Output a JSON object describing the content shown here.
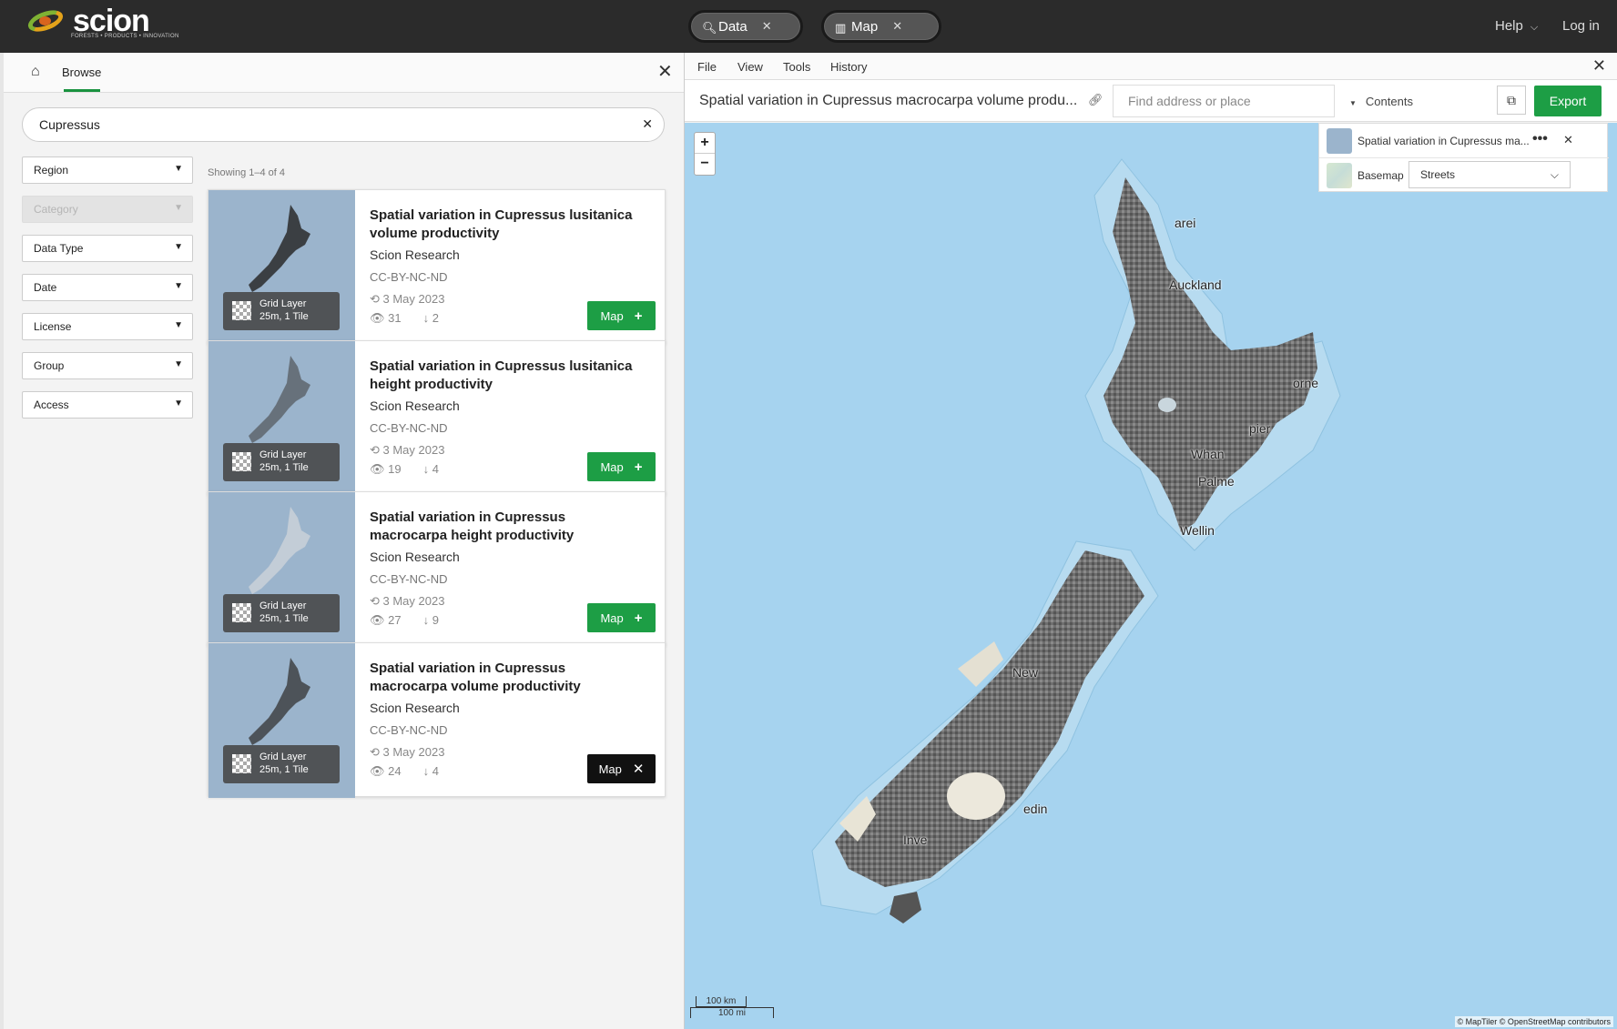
{
  "app": {
    "logo_text": "scion",
    "logo_tagline": "FORESTS • PRODUCTS • INNOVATION"
  },
  "topbar": {
    "tabs": [
      {
        "label": "Data",
        "icon": "search-icon"
      },
      {
        "label": "Map",
        "icon": "map-icon"
      }
    ],
    "help_label": "Help",
    "login_label": "Log in"
  },
  "browse": {
    "tab_label": "Browse",
    "search_value": "Cupressus",
    "showing": "Showing 1–4 of 4",
    "filters": [
      {
        "label": "Region",
        "disabled": false
      },
      {
        "label": "Category",
        "disabled": true
      },
      {
        "label": "Data Type",
        "disabled": false
      },
      {
        "label": "Date",
        "disabled": false
      },
      {
        "label": "License",
        "disabled": false
      },
      {
        "label": "Group",
        "disabled": false
      },
      {
        "label": "Access",
        "disabled": false
      }
    ],
    "results": [
      {
        "title_line1": "Spatial variation in Cupressus lusitanica",
        "title_line2": "volume productivity",
        "org": "Scion Research",
        "license": "CC-BY-NC-ND",
        "date": "3 May 2023",
        "views": "31",
        "downloads": "2",
        "badge_line1": "Grid Layer",
        "badge_line2": "25m, 1 Tile",
        "button_label": "Map",
        "in_map": false
      },
      {
        "title_line1": "Spatial variation in Cupressus lusitanica",
        "title_line2": "height productivity",
        "org": "Scion Research",
        "license": "CC-BY-NC-ND",
        "date": "3 May 2023",
        "views": "19",
        "downloads": "4",
        "badge_line1": "Grid Layer",
        "badge_line2": "25m, 1 Tile",
        "button_label": "Map",
        "in_map": false
      },
      {
        "title_line1": "Spatial variation in Cupressus",
        "title_line2": "macrocarpa height productivity",
        "org": "Scion Research",
        "license": "CC-BY-NC-ND",
        "date": "3 May 2023",
        "views": "27",
        "downloads": "9",
        "badge_line1": "Grid Layer",
        "badge_line2": "25m, 1 Tile",
        "button_label": "Map",
        "in_map": false
      },
      {
        "title_line1": "Spatial variation in Cupressus",
        "title_line2": "macrocarpa volume productivity",
        "org": "Scion Research",
        "license": "CC-BY-NC-ND",
        "date": "3 May 2023",
        "views": "24",
        "downloads": "4",
        "badge_line1": "Grid Layer",
        "badge_line2": "25m, 1 Tile",
        "button_label": "Map",
        "in_map": true
      }
    ]
  },
  "mapview": {
    "menu": [
      "File",
      "View",
      "Tools",
      "History"
    ],
    "title": "Spatial variation in Cupressus macrocarpa volume produ...",
    "find_placeholder": "Find address or place",
    "contents_label": "Contents",
    "export_label": "Export",
    "layers": [
      {
        "name": "Spatial variation in Cupressus ma..."
      },
      {
        "name": "Basemap",
        "select_value": "Streets"
      }
    ],
    "places": [
      "arei",
      "Auckland",
      "orne",
      "pier",
      "Whan",
      "Palme",
      "Wellin",
      "New",
      "edin",
      "Inve"
    ],
    "scale_km": "100 km",
    "scale_mi": "100 mi",
    "attribution": "© MapTiler © OpenStreetMap contributors",
    "colors": {
      "water": "#a6d3ef",
      "accent": "#1d9e45"
    }
  }
}
